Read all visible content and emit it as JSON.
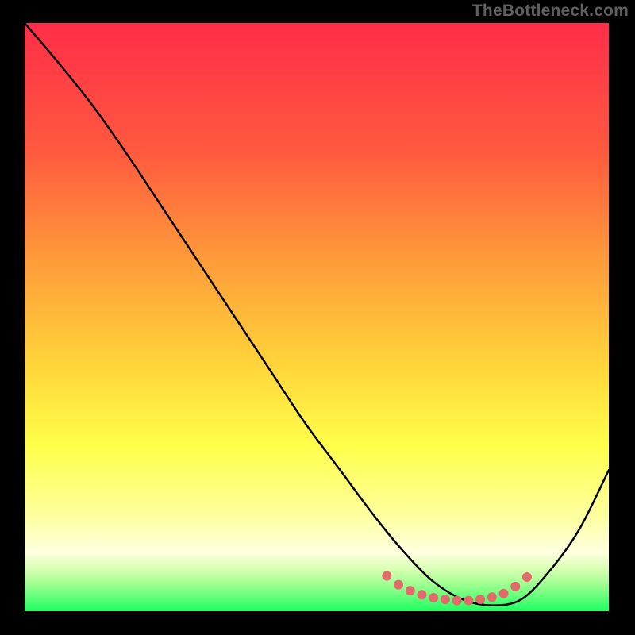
{
  "watermark": "TheBottleneck.com",
  "colors": {
    "gradient_top": "#ff2d48",
    "gradient_mid1": "#ff8a3a",
    "gradient_mid2": "#ffd93a",
    "gradient_mid3": "#ffff55",
    "gradient_mid4": "#fcffc0",
    "gradient_bottom": "#23ff6a",
    "curve": "#000000",
    "dots": "#e36a6a",
    "frame": "#000000"
  },
  "chart_data": {
    "type": "line",
    "title": "",
    "xlabel": "",
    "ylabel": "",
    "xlim": [
      0,
      100
    ],
    "ylim": [
      0,
      100
    ],
    "series": [
      {
        "name": "bottleneck-curve",
        "x": [
          0,
          6,
          12,
          18,
          24,
          30,
          36,
          42,
          48,
          54,
          60,
          65,
          70,
          75,
          80,
          85,
          90,
          95,
          100
        ],
        "y": [
          100,
          93,
          85.5,
          77,
          68,
          59,
          50,
          41,
          32,
          24,
          16,
          10,
          5,
          2,
          1,
          2,
          7,
          14,
          24
        ]
      }
    ],
    "dot_cluster": {
      "name": "optimal-range-dots",
      "x": [
        62,
        64,
        66,
        68,
        70,
        72,
        74,
        76,
        78,
        80,
        82,
        84,
        86
      ],
      "y": [
        6,
        4.5,
        3.5,
        2.8,
        2.3,
        2.0,
        1.8,
        1.8,
        2.0,
        2.4,
        3.0,
        4.2,
        5.8
      ]
    }
  }
}
